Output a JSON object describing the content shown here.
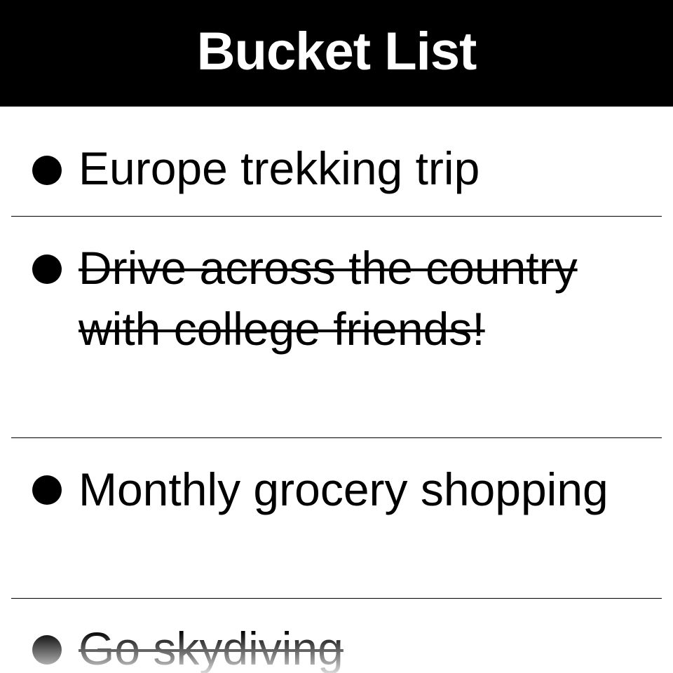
{
  "header": {
    "title": "Bucket List"
  },
  "list": {
    "items": [
      {
        "label": "Europe trekking trip",
        "completed": false
      },
      {
        "label": "Drive across the country with college friends!",
        "completed": true
      },
      {
        "label": "Monthly grocery shopping",
        "completed": false
      },
      {
        "label": "Go skydiving",
        "completed": true
      }
    ]
  },
  "colors": {
    "header_background": "#000000",
    "header_text": "#ffffff",
    "page_background": "#ffffff",
    "text": "#000000"
  },
  "icons": {
    "bullet": "bullet-dot-icon"
  }
}
